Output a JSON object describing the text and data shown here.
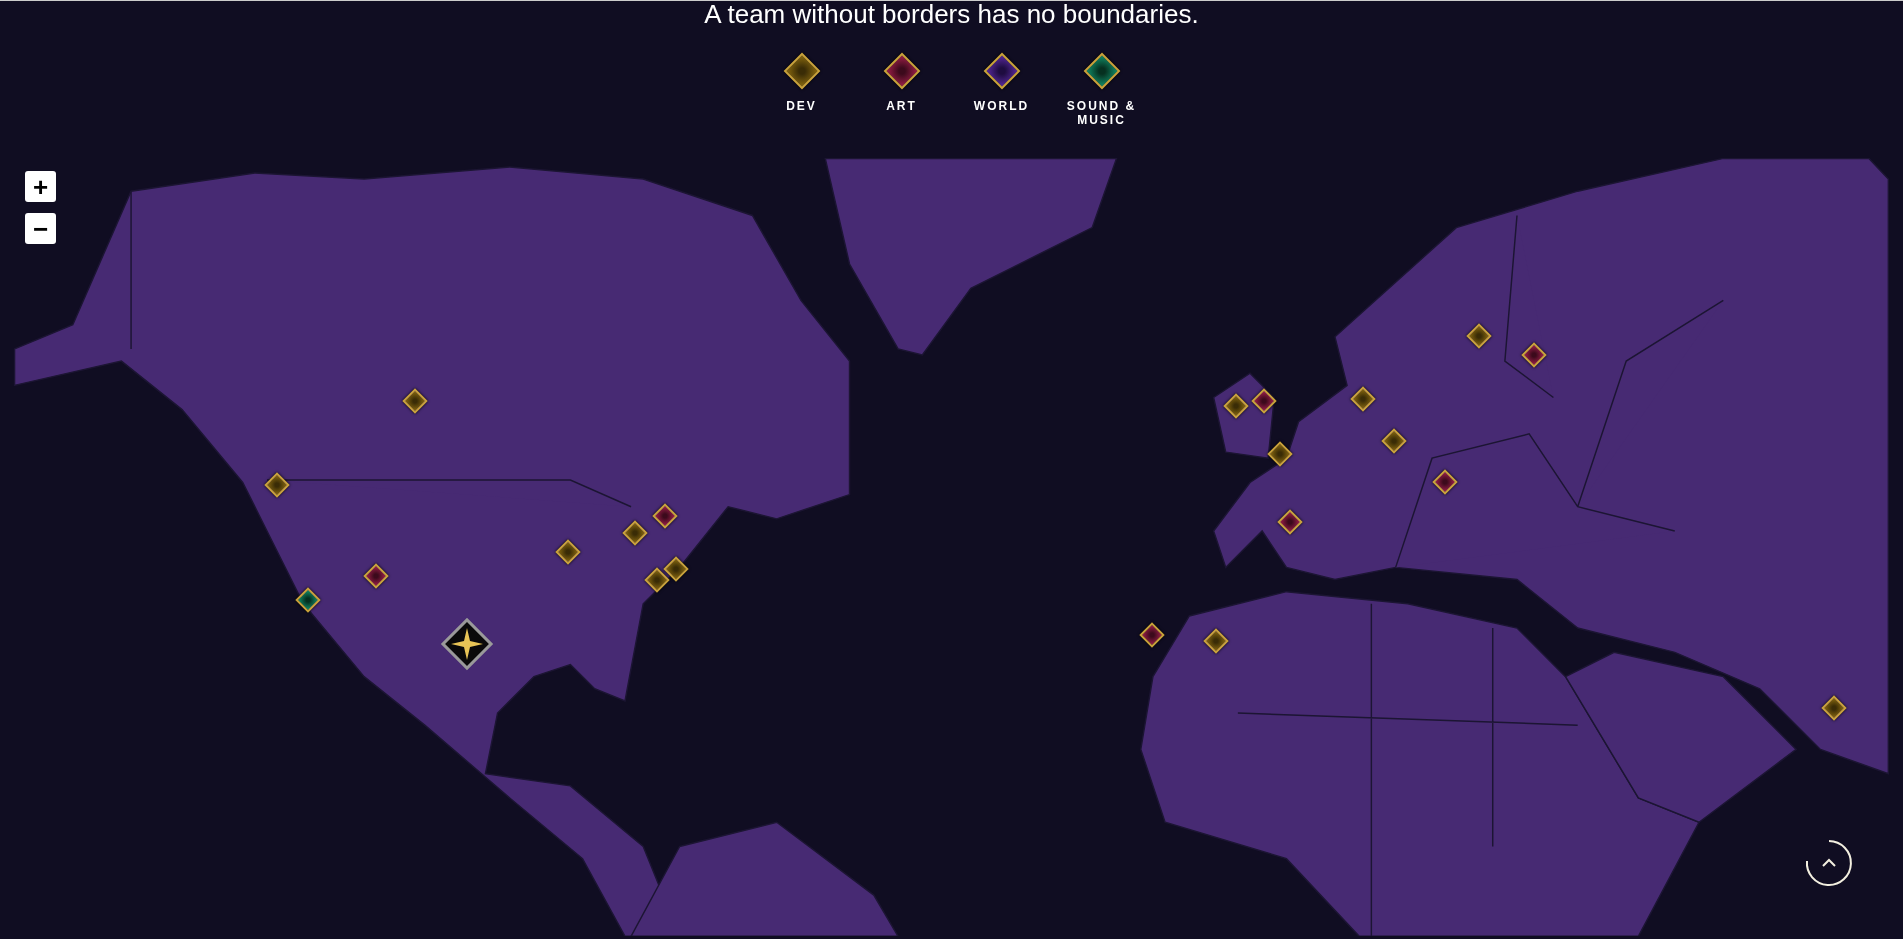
{
  "heading": "A team without borders has no boundaries.",
  "legend": [
    {
      "kind": "dev",
      "label": "DEV"
    },
    {
      "kind": "art",
      "label": "ART"
    },
    {
      "kind": "world",
      "label": "WORLD"
    },
    {
      "kind": "sound",
      "label": "SOUND & MUSIC"
    }
  ],
  "zoom_controls": [
    "+",
    "−"
  ],
  "pins": [
    {
      "kind": "dev"
    },
    {
      "kind": "dev"
    },
    {
      "kind": "art"
    },
    {
      "kind": "sound"
    },
    {
      "kind": "hq"
    },
    {
      "kind": "dev"
    },
    {
      "kind": "dev"
    },
    {
      "kind": "art"
    },
    {
      "kind": "dev"
    },
    {
      "kind": "dev"
    },
    {
      "kind": "art"
    },
    {
      "kind": "dev"
    },
    {
      "kind": "dev"
    },
    {
      "kind": "art"
    },
    {
      "kind": "dev"
    },
    {
      "kind": "art"
    },
    {
      "kind": "dev"
    },
    {
      "kind": "dev"
    },
    {
      "kind": "art"
    },
    {
      "kind": "dev"
    },
    {
      "kind": "art"
    },
    {
      "kind": "dev"
    }
  ]
}
